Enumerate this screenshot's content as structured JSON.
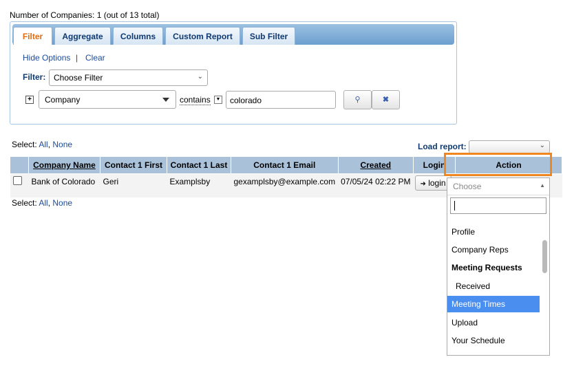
{
  "summary": "Number of Companies: 1 (out of 13 total)",
  "tabs": [
    "Filter",
    "Aggregate",
    "Columns",
    "Custom Report",
    "Sub Filter"
  ],
  "options": {
    "hide": "Hide Options",
    "sep": "|",
    "clear": "Clear"
  },
  "filter": {
    "label": "Filter:",
    "choose": "Choose Filter",
    "field": "Company",
    "operator": "contains",
    "value": "colorado"
  },
  "select": {
    "label": "Select:",
    "all": "All",
    "sep": ",",
    "none": "None"
  },
  "load_report": "Load report:",
  "columns": [
    "Company Name",
    "Contact 1 First",
    "Contact 1 Last",
    "Contact 1 Email",
    "Created",
    "Login",
    "Action"
  ],
  "rows": [
    {
      "company": "Bank of Colorado",
      "first": "Geri",
      "last": "Examplsby",
      "email": "gexamplsby@example.com",
      "created": "07/05/24 02:22 PM",
      "login": "login"
    }
  ],
  "action_dropdown": {
    "placeholder": "Choose",
    "items": [
      "Profile",
      "Company Reps",
      "Meeting Requests",
      "Received",
      "Meeting Times",
      "Upload",
      "Your Schedule"
    ],
    "highlighted": "Meeting Times"
  },
  "colors": {
    "accent": "#f0861f",
    "highlight": "#4a8ef0",
    "header": "#a9c2da"
  }
}
